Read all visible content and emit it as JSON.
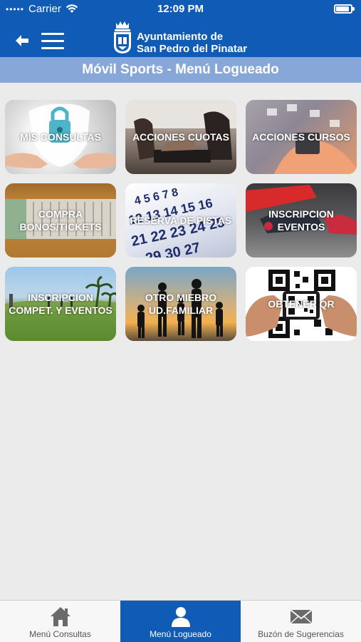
{
  "status_bar": {
    "signal": "•••••",
    "carrier": "Carrier",
    "time": "12:09 PM"
  },
  "header": {
    "brand_line1": "Ayuntamiento de",
    "brand_line2": "San Pedro del Pinatar"
  },
  "subheader": {
    "title": "Móvil Sports - Menú Logueado"
  },
  "tiles": [
    {
      "label": "MIS CONSULTAS"
    },
    {
      "label": "ACCIONES CUOTAS"
    },
    {
      "label": "ACCIONES CURSOS"
    },
    {
      "label": "COMPRA BONOS/TICKETS"
    },
    {
      "label": "RESERVA DE PISTAS"
    },
    {
      "label": "INSCRIPCION EVENTOS"
    },
    {
      "label": "INSCRIPCION COMPET. Y EVENTOS"
    },
    {
      "label": "OTRO MIEBRO UD.FAMILIAR"
    },
    {
      "label": "OBTENER QR"
    }
  ],
  "tabbar": {
    "tabs": [
      {
        "label": "Menú Consultas",
        "icon": "home-icon"
      },
      {
        "label": "Menú Logueado",
        "icon": "user-icon"
      },
      {
        "label": "Buzón de Sugerencias",
        "icon": "envelope-icon"
      }
    ],
    "active_index": 1
  },
  "colors": {
    "primary": "#0f5bb5",
    "subheader": "#86a7d8",
    "background": "#ebebeb"
  }
}
